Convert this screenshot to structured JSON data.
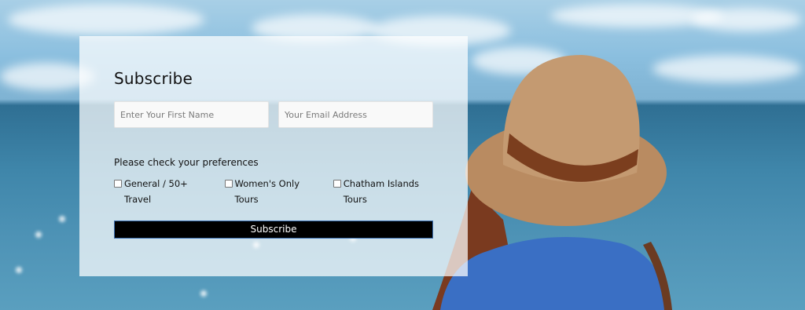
{
  "form": {
    "title": "Subscribe",
    "first_name_placeholder": "Enter Your First Name",
    "email_placeholder": "Your Email Address",
    "preferences_label": "Please check your preferences",
    "options": [
      {
        "label": "General / 50+ Travel",
        "checked": false
      },
      {
        "label": "Women's Only Tours",
        "checked": false
      },
      {
        "label": "Chatham Islands Tours",
        "checked": false
      }
    ],
    "submit_label": "Subscribe"
  },
  "colors": {
    "panel": "#ffffff",
    "button_bg": "#000000",
    "button_border": "#3b6fb0",
    "sea": "#3f86aa",
    "sky": "#8bbfdf"
  }
}
